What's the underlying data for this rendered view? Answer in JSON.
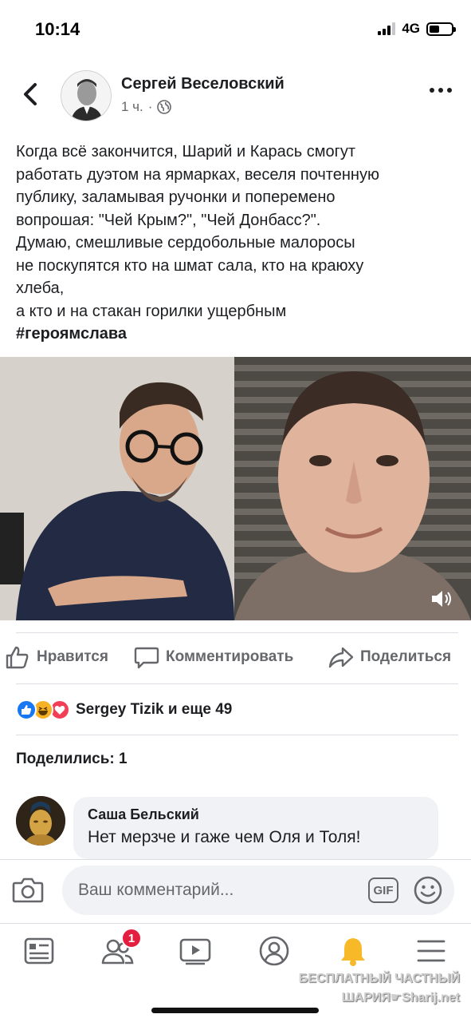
{
  "status_bar": {
    "time": "10:14",
    "network": "4G",
    "battery_level": 0.45
  },
  "post": {
    "author": "Сергей Веселовский",
    "time_ago": "1 ч.",
    "separator": "·",
    "privacy_icon": "globe-icon",
    "text_lines": [
      "Когда всё закончится, Шарий и Карась смогут",
      "работать дуэтом на ярмарках, веселя почтенную",
      "публику, заламывая ручонки и поперемено",
      "вопрошая: \"Чей Крым?\", \"Чей Донбасс?\".",
      "Думаю, смешливые сердобольные малоросы",
      "не поскупятся кто на шмат сала, кто на краюху",
      "хлеба,",
      "а кто и на стакан горилки ущербным"
    ],
    "hashtag": "#героямслава"
  },
  "actions": {
    "like": "Нравится",
    "comment": "Комментировать",
    "share": "Поделиться"
  },
  "reactions": {
    "icons": [
      "like-icon",
      "haha-icon",
      "love-icon"
    ],
    "text": "Sergey Tizik и еще 49"
  },
  "shares": "Поделились: 1",
  "comment": {
    "author": "Саша Бельский",
    "text": "Нет мерзче и гаже чем Оля и Толя!"
  },
  "composer": {
    "placeholder": "Ваш комментарий...",
    "gif_label": "GIF"
  },
  "tab_bar": {
    "items": [
      "feed-icon",
      "friends-icon",
      "watch-icon",
      "profile-icon",
      "notifications-icon",
      "menu-icon"
    ],
    "friends_badge": "1",
    "active_color": "#f7b928"
  },
  "watermark": {
    "line1": "БЕСПЛАТНЫЙ ЧАСТНЫЙ",
    "line2": "ШАРИЯ☛Sharij.net"
  },
  "colors": {
    "brand_blue": "#1877f2",
    "text_primary": "#1c1e21",
    "text_secondary": "#65676b",
    "badge_red": "#e41e3f"
  }
}
